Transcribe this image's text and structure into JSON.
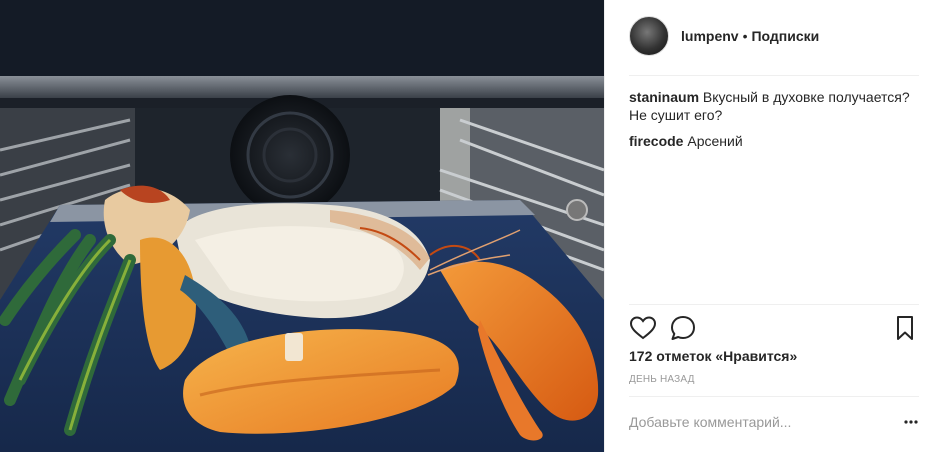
{
  "post": {
    "author": "lumpenv",
    "separator": "•",
    "follow_label": "Подписки"
  },
  "comments": [
    {
      "user": "staninaum",
      "text": "Вкусный в духовке получается? Не сушит его?"
    },
    {
      "user": "firecode",
      "text": "Арсений"
    }
  ],
  "actions": {
    "like_icon": "heart-outline-icon",
    "comment_icon": "comment-bubble-icon",
    "save_icon": "bookmark-icon"
  },
  "likes_text": "172 отметок «Нравится»",
  "time_text": "ДЕНЬ НАЗАД",
  "add_comment": {
    "placeholder": "Добавьте комментарий...",
    "more_icon": "more-options-icon"
  },
  "photo": {
    "subject_icon": "lobster-in-oven-photo"
  }
}
